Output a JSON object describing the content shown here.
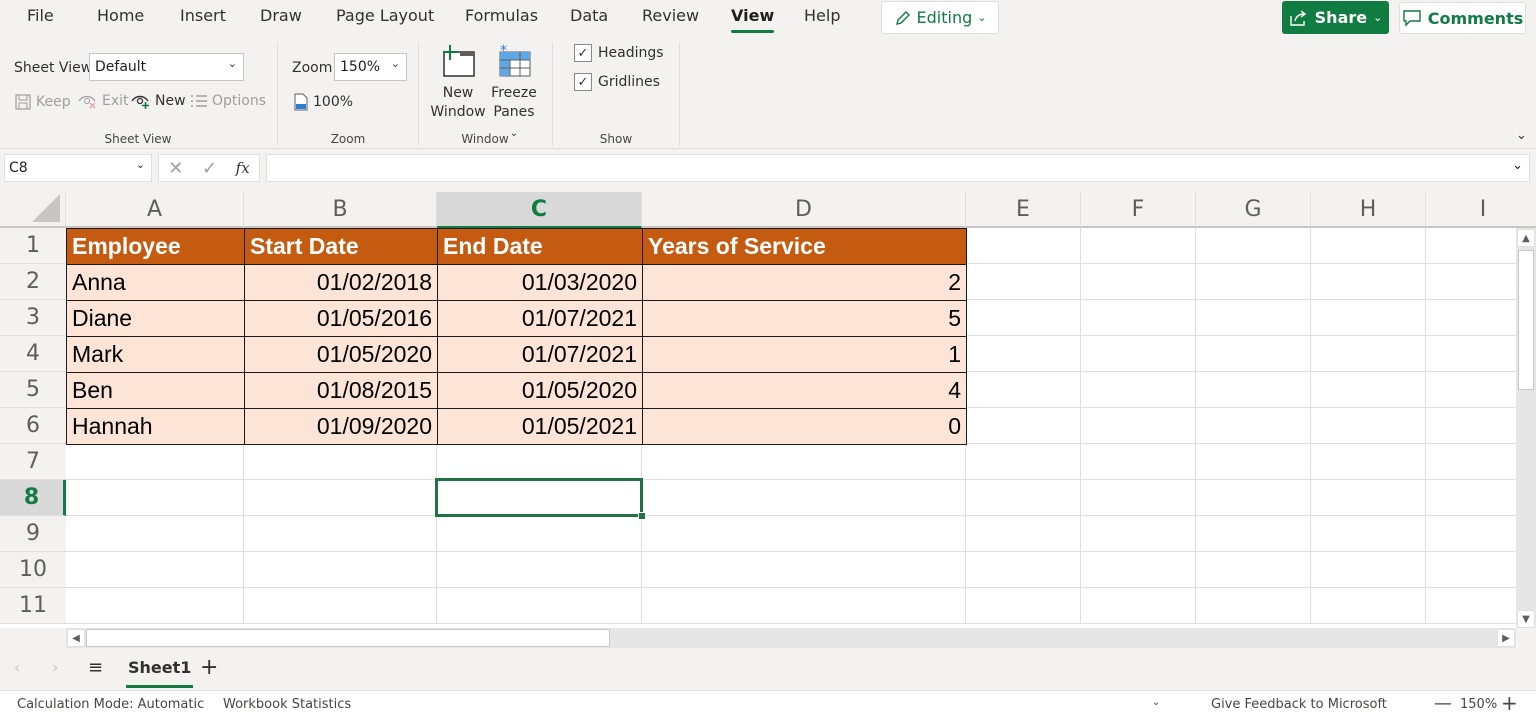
{
  "menu": {
    "tabs": [
      "File",
      "Home",
      "Insert",
      "Draw",
      "Page Layout",
      "Formulas",
      "Data",
      "Review",
      "View",
      "Help"
    ],
    "active_tab": "View",
    "editing_label": "Editing",
    "share_label": "Share",
    "comments_label": "Comments"
  },
  "ribbon": {
    "sheet_view": {
      "label": "Sheet View",
      "select_value": "Default",
      "keep": "Keep",
      "exit": "Exit",
      "new": "New",
      "options": "Options",
      "group_label": "Sheet View"
    },
    "zoom": {
      "label": "Zoom",
      "select_value": "150%",
      "hundred": "100%",
      "group_label": "Zoom"
    },
    "window": {
      "new_window_line1": "New",
      "new_window_line2": "Window",
      "freeze_line1": "Freeze",
      "freeze_line2": "Panes",
      "group_label": "Window"
    },
    "show": {
      "headings": "Headings",
      "headings_checked": true,
      "gridlines": "Gridlines",
      "gridlines_checked": true,
      "group_label": "Show"
    }
  },
  "formula_bar": {
    "name_box": "C8",
    "fx": "fx",
    "formula": ""
  },
  "grid": {
    "columns": [
      "A",
      "B",
      "C",
      "D",
      "E",
      "F",
      "G",
      "H",
      "I"
    ],
    "selected_column": "C",
    "rows": [
      "1",
      "2",
      "3",
      "4",
      "5",
      "6",
      "7",
      "8",
      "9",
      "10",
      "11"
    ],
    "selected_row": "8",
    "selected_cell": "C8"
  },
  "table": {
    "headers": [
      "Employee",
      "Start Date",
      "End Date",
      "Years of Service"
    ],
    "rows": [
      [
        "Anna",
        "01/02/2018",
        "01/03/2020",
        "2"
      ],
      [
        "Diane",
        "01/05/2016",
        "01/07/2021",
        "5"
      ],
      [
        "Mark",
        "01/05/2020",
        "01/07/2021",
        "1"
      ],
      [
        "Ben",
        "01/08/2015",
        "01/05/2020",
        "4"
      ],
      [
        "Hannah",
        "01/09/2020",
        "01/05/2021",
        "0"
      ]
    ],
    "header_color": "#c55a11",
    "body_color": "#fce4d6"
  },
  "sheets": {
    "tabs": [
      "Sheet1"
    ],
    "active": "Sheet1"
  },
  "status": {
    "calc_mode": "Calculation Mode: Automatic",
    "workbook_stats": "Workbook Statistics",
    "feedback": "Give Feedback to Microsoft",
    "zoom": "150%"
  },
  "colors": {
    "accent": "#107c41",
    "selection": "#217346"
  }
}
